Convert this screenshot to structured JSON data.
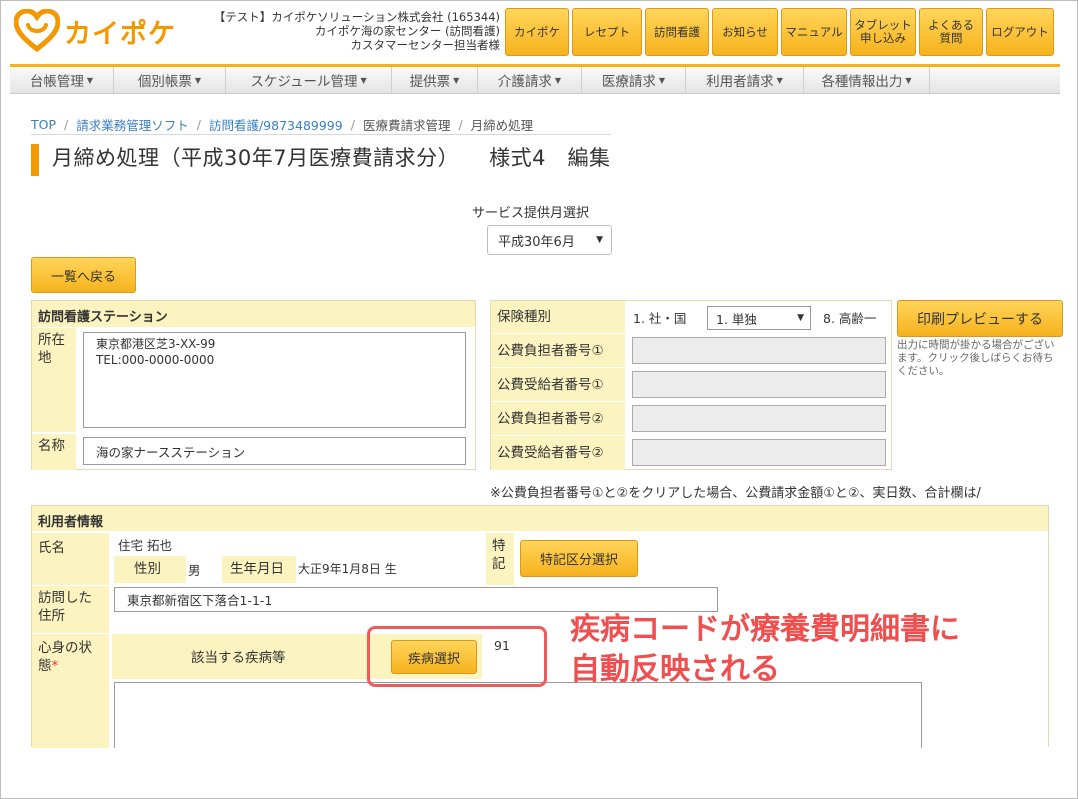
{
  "header": {
    "logo_text": "カイポケ",
    "company_lines": [
      "【テスト】カイポケソリューション株式会社 (165344)",
      "カイポケ海の家センター (訪問看護)",
      "カスタマーセンター担当者様"
    ],
    "buttons": [
      "カイポケ",
      "レセプト",
      "訪問看護",
      "お知らせ",
      "マニュアル",
      "タブレット\n申し込み",
      "よくある\n質問",
      "ログアウト"
    ]
  },
  "nav": {
    "items": [
      "台帳管理",
      "個別帳票",
      "スケジュール管理",
      "提供票",
      "介護請求",
      "医療請求",
      "利用者請求",
      "各種情報出力"
    ]
  },
  "breadcrumb": {
    "items": [
      "TOP",
      "請求業務管理ソフト",
      "訪問看護/9873489999",
      "医療費請求管理"
    ],
    "current": "月締め処理"
  },
  "page": {
    "title": "月締め処理（平成30年7月医療費請求分）",
    "subtitle": "様式4　編集"
  },
  "service_month": {
    "label": "サービス提供月選択",
    "value": "平成30年6月"
  },
  "back_button": "一覧へ戻る",
  "station": {
    "heading": "訪問看護ステーション",
    "address_label": "所在\n地",
    "address_lines": [
      "東京都港区芝3-XX-99",
      "TEL:000-0000-0000"
    ],
    "name_label": "名称",
    "name_value": "海の家ナースステーション"
  },
  "insurance": {
    "type_label": "保険種別",
    "type_first": "1. 社・国",
    "type_select": "1. 単独",
    "type_third": "8. 高齢一",
    "rows": [
      "公費負担者番号①",
      "公費受給者番号①",
      "公費負担者番号②",
      "公費受給者番号②"
    ]
  },
  "print": {
    "button": "印刷プレビューする",
    "note": "出力に時間が掛かる場合がございます。クリック後しばらくお待ちください。"
  },
  "notice": "※公費負担者番号①と②をクリアした場合、公費請求金額①と②、実日数、合計欄は/",
  "user": {
    "heading": "利用者情報",
    "name_label": "氏名",
    "name_value": "住宅 拓也",
    "sex_label": "性別",
    "sex_value": "男",
    "birth_label": "生年月日",
    "birth_value": "大正9年1月8日 生",
    "special_label": "特\n記",
    "special_button": "特記区分選択",
    "visit_label": "訪問した\n住所",
    "visit_value": "東京都新宿区下落合1-1-1",
    "condition_label": "心身の状\n態",
    "required_mark": "*",
    "disease_label": "該当する疾病等",
    "disease_button": "疾病選択",
    "disease_code": "91"
  },
  "annotation": {
    "line1": "疾病コードが療養費明細書に",
    "line2": "自動反映される"
  },
  "colors": {
    "accent": "#f39800",
    "button": "#f6b21c",
    "label_bg": "#fbf3c0",
    "annotation": "#ef4f4f"
  }
}
